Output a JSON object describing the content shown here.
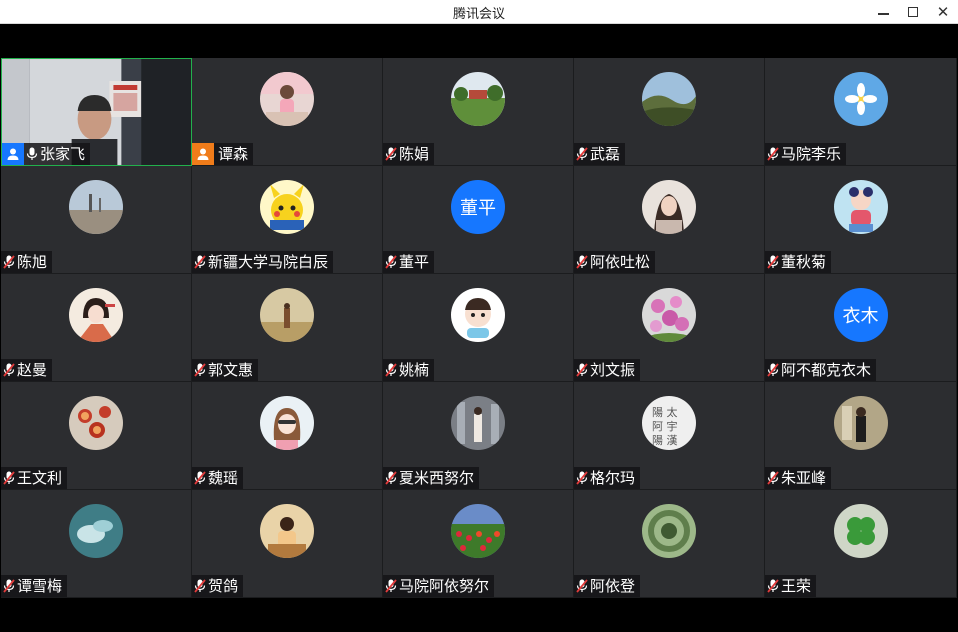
{
  "window": {
    "title": "腾讯会议"
  },
  "colors": {
    "tile_bg": "#2c2d30",
    "active_border": "#22b14c",
    "host_badge": "#1677ff",
    "cohost_badge": "#f07c1a",
    "muted_mic": "#e23b3b",
    "text_avatar": "#1677ff"
  },
  "participants": [
    {
      "name": "张家飞",
      "avatar": "video",
      "mic": "on",
      "badge": "host"
    },
    {
      "name": "谭森",
      "avatar": "photo-girl-pink",
      "mic": "none",
      "badge": "cohost"
    },
    {
      "name": "陈娟",
      "avatar": "photo-landscape-house",
      "mic": "muted"
    },
    {
      "name": "武磊",
      "avatar": "photo-hills",
      "mic": "muted"
    },
    {
      "name": "马院李乐",
      "avatar": "photo-flower-sky",
      "mic": "muted"
    },
    {
      "name": "陈旭",
      "avatar": "photo-beach",
      "mic": "muted"
    },
    {
      "name": "新疆大学马院白辰",
      "avatar": "photo-pikachu",
      "mic": "muted"
    },
    {
      "name": "董平",
      "avatar": "text",
      "avatar_text": "董平",
      "mic": "muted"
    },
    {
      "name": "阿依吐松",
      "avatar": "photo-woman",
      "mic": "muted"
    },
    {
      "name": "董秋菊",
      "avatar": "photo-cartoon-kid",
      "mic": "muted"
    },
    {
      "name": "赵曼",
      "avatar": "photo-cartoon-girl",
      "mic": "muted"
    },
    {
      "name": "郭文惠",
      "avatar": "photo-desert-person",
      "mic": "muted"
    },
    {
      "name": "姚楠",
      "avatar": "photo-cartoon-boy",
      "mic": "muted"
    },
    {
      "name": "刘文振",
      "avatar": "photo-pink-flowers",
      "mic": "muted"
    },
    {
      "name": "阿不都克衣木",
      "avatar": "text",
      "avatar_text": "衣木",
      "mic": "muted"
    },
    {
      "name": "王文利",
      "avatar": "photo-tea",
      "mic": "muted"
    },
    {
      "name": "魏瑶",
      "avatar": "photo-cartoon-girl2",
      "mic": "muted"
    },
    {
      "name": "夏米西努尔",
      "avatar": "photo-city-person",
      "mic": "muted"
    },
    {
      "name": "格尔玛",
      "avatar": "photo-calligraphy",
      "mic": "muted"
    },
    {
      "name": "朱亚峰",
      "avatar": "photo-man-standing",
      "mic": "muted"
    },
    {
      "name": "谭雪梅",
      "avatar": "photo-teal-hands",
      "mic": "muted"
    },
    {
      "name": "贺鸽",
      "avatar": "photo-girl-reading",
      "mic": "muted"
    },
    {
      "name": "马院阿依努尔",
      "avatar": "photo-tulips",
      "mic": "muted"
    },
    {
      "name": "阿依登",
      "avatar": "photo-green-spiral",
      "mic": "muted"
    },
    {
      "name": "王荣",
      "avatar": "photo-clover",
      "mic": "muted"
    }
  ]
}
